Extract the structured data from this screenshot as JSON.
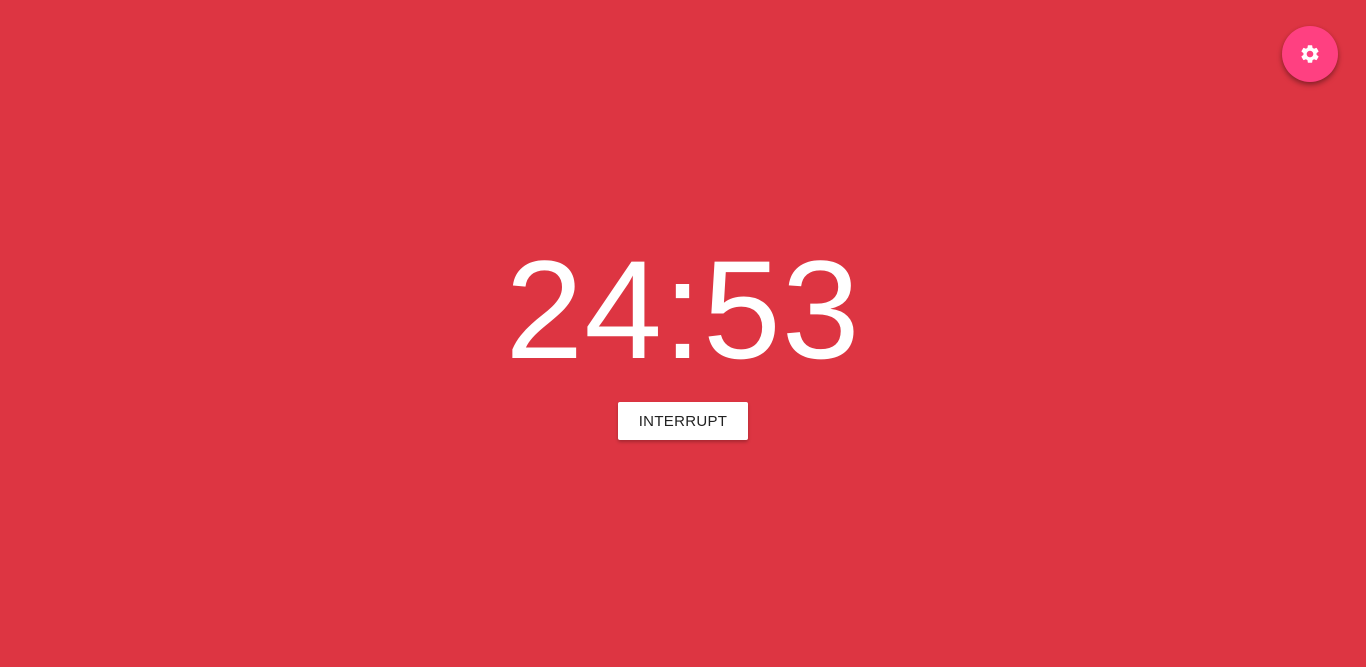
{
  "theme": {
    "background": "#dd3542",
    "fab_color": "#ff4081",
    "text_color": "#ffffff"
  },
  "settings": {
    "icon": "gear-icon"
  },
  "timer": {
    "display": "24:53"
  },
  "actions": {
    "interrupt_label": "INTERRUPT"
  }
}
